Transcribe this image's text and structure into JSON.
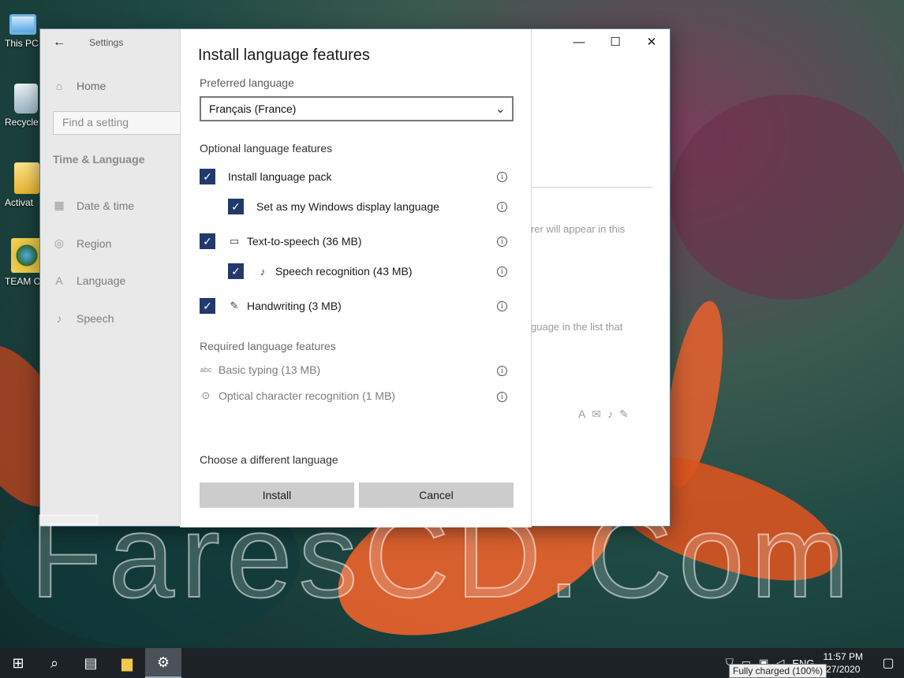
{
  "desktop": {
    "icons": [
      {
        "label": "This PC",
        "icon": "computer-icon"
      },
      {
        "label": "Recycle",
        "icon": "recycle-bin-icon"
      },
      {
        "label": "Activat",
        "icon": "folder-icon"
      },
      {
        "label": "TEAM C",
        "icon": "globe-icon"
      }
    ],
    "watermark": "FaresCD.Com"
  },
  "window": {
    "title": "Settings",
    "controls": {
      "minimize": "—",
      "maximize": "☐",
      "close": "✕"
    }
  },
  "sidebar": {
    "back": "←",
    "home": "Home",
    "search_placeholder": "Find a setting",
    "section": "Time & Language",
    "items": [
      {
        "label": "Date & time",
        "icon": "calendar-icon"
      },
      {
        "label": "Region",
        "icon": "globe-icon"
      },
      {
        "label": "Language",
        "icon": "language-icon"
      },
      {
        "label": "Speech",
        "icon": "microphone-icon"
      }
    ]
  },
  "background_page": {
    "text1": "rer will appear in this",
    "text2": "guage in the list that"
  },
  "dialog": {
    "title": "Install language features",
    "preferred_label": "Preferred language",
    "preferred_value": "Français (France)",
    "optional_head": "Optional language features",
    "optional": [
      {
        "label": "Install language pack",
        "checked": true
      },
      {
        "label": "Set as my Windows display language",
        "checked": true
      },
      {
        "label": "Text-to-speech (36 MB)",
        "checked": true,
        "icon": "speech-bubble-icon"
      },
      {
        "label": "Speech recognition (43 MB)",
        "checked": true,
        "icon": "microphone-icon"
      },
      {
        "label": "Handwriting (3 MB)",
        "checked": true,
        "icon": "pen-icon"
      }
    ],
    "required_head": "Required language features",
    "required": [
      {
        "label": "Basic typing (13 MB)",
        "icon": "abc-icon"
      },
      {
        "label": "Optical character recognition (1 MB)",
        "icon": "ocr-icon"
      }
    ],
    "choose_link": "Choose a different language",
    "install": "Install",
    "cancel": "Cancel"
  },
  "taskbar": {
    "lang": "ENG",
    "time": "11:57 PM",
    "date": "27/2020",
    "tooltip": "Fully charged (100%)"
  }
}
